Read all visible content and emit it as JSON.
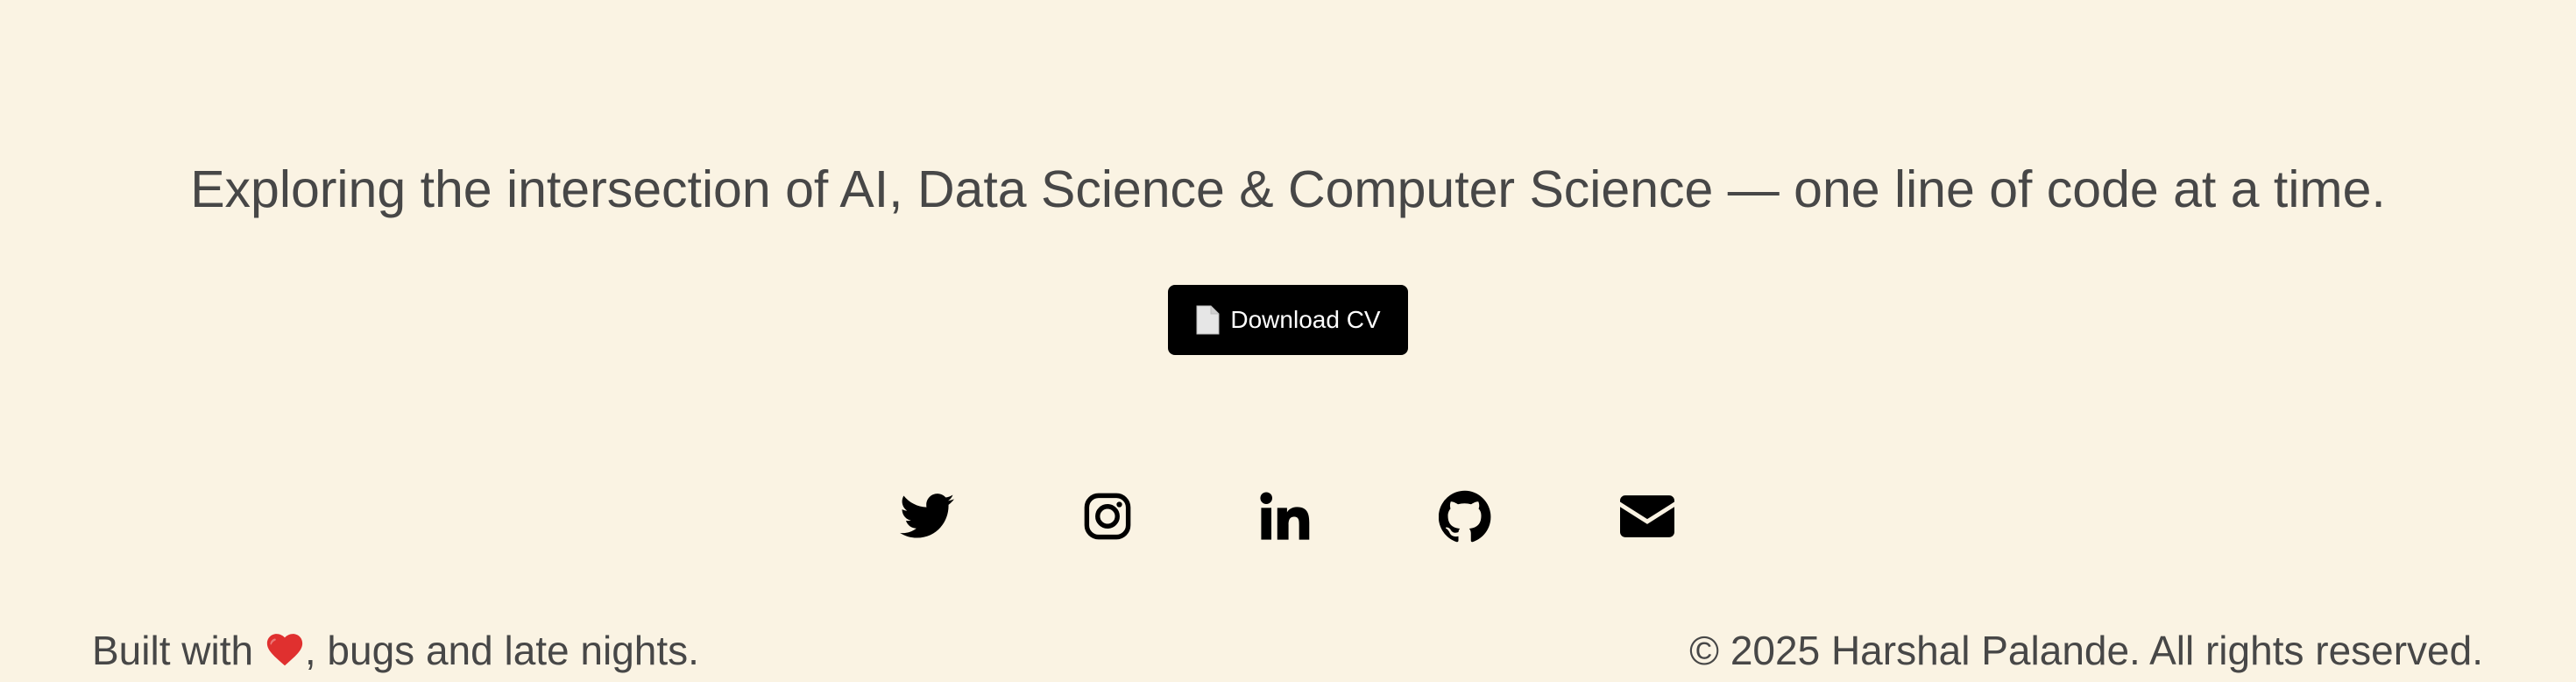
{
  "hero": {
    "tagline": "Exploring the intersection of AI, Data Science & Computer Science — one line of code at a time."
  },
  "cv_button": {
    "icon": "document-icon",
    "label": "Download CV"
  },
  "social_links": [
    {
      "name": "twitter",
      "icon": "twitter-icon"
    },
    {
      "name": "instagram",
      "icon": "instagram-icon"
    },
    {
      "name": "linkedin",
      "icon": "linkedin-icon"
    },
    {
      "name": "github",
      "icon": "github-icon"
    },
    {
      "name": "email",
      "icon": "mail-icon"
    }
  ],
  "footer": {
    "built_prefix": "Built with ",
    "built_icon": "heart-icon",
    "built_suffix": ", bugs and late nights.",
    "copyright": "© 2025 Harshal Palande. All rights reserved."
  },
  "colors": {
    "background": "#faf3e3",
    "text": "#474747",
    "button_bg": "#000000",
    "button_text": "#ffffff",
    "icon": "#000000",
    "heart": "#e0302f"
  }
}
